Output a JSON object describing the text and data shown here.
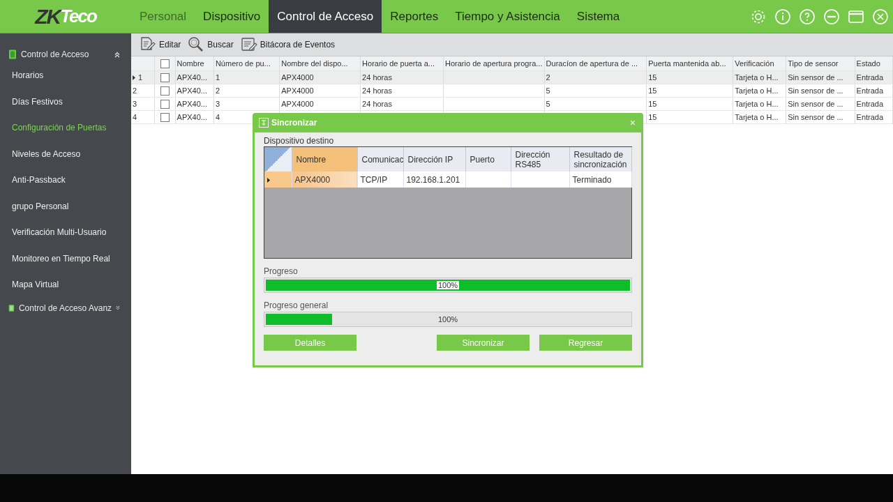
{
  "logo": {
    "dark": "ZK",
    "light": "Teco"
  },
  "nav": [
    {
      "label": "Personal",
      "selected": false,
      "dim": true
    },
    {
      "label": "Dispositivo",
      "selected": false,
      "dim": false
    },
    {
      "label": "Control de Acceso",
      "selected": true,
      "dim": false
    },
    {
      "label": "Reportes",
      "selected": false,
      "dim": false
    },
    {
      "label": "Tiempo y Asistencia",
      "selected": false,
      "dim": false
    },
    {
      "label": "Sistema",
      "selected": false,
      "dim": false
    }
  ],
  "sidebar": {
    "sections": [
      {
        "title": "Control de Acceso",
        "expanded": true,
        "items": [
          {
            "label": "Horarios",
            "selected": false
          },
          {
            "label": "Días Festivos",
            "selected": false
          },
          {
            "label": "Configuración de Puertas",
            "selected": true
          },
          {
            "label": "Niveles de Acceso",
            "selected": false
          },
          {
            "label": "Anti-Passback",
            "selected": false
          },
          {
            "label": "grupo Personal",
            "selected": false
          },
          {
            "label": "Verificación Multi-Usuario",
            "selected": false
          },
          {
            "label": "Monitoreo en Tiempo Real",
            "selected": false
          },
          {
            "label": "Mapa Virtual",
            "selected": false
          }
        ]
      },
      {
        "title": "Control de Acceso Avanz",
        "expanded": false
      }
    ]
  },
  "toolbar": [
    {
      "label": "Editar"
    },
    {
      "label": "Buscar"
    },
    {
      "label": "Bitácora de Eventos"
    }
  ],
  "table": {
    "header_checked": false,
    "columns": [
      "Nombre",
      "Número de pu...",
      "Nombre del dispo...",
      "Horario de puerta a...",
      "Horario de apertura progra...",
      "Duracíon de apertura de ...",
      "Puerta mantenida ab...",
      "Verificación",
      "Tipo de sensor",
      "Estado"
    ],
    "rows": [
      {
        "number": "1",
        "selected": true,
        "checked": false,
        "cells": [
          "APX40...",
          "1",
          "APX4000",
          "24 horas",
          null,
          "2",
          "15",
          "Tarjeta o H...",
          "Sin sensor de ...",
          "Entrada"
        ]
      },
      {
        "number": "2",
        "selected": false,
        "checked": false,
        "cells": [
          "APX40...",
          "2",
          "APX4000",
          "24 horas",
          null,
          "5",
          "15",
          "Tarjeta o H...",
          "Sin sensor de ...",
          "Entrada"
        ]
      },
      {
        "number": "3",
        "selected": false,
        "checked": false,
        "cells": [
          "APX40...",
          "3",
          "APX4000",
          "24 horas",
          null,
          "5",
          "15",
          "Tarjeta o H...",
          "Sin sensor de ...",
          "Entrada"
        ]
      },
      {
        "number": "4",
        "selected": false,
        "checked": false,
        "cells": [
          "APX40...",
          "4",
          null,
          null,
          null,
          null,
          "15",
          "Tarjeta o H...",
          "Sin sensor de ...",
          "Entrada"
        ]
      }
    ]
  },
  "dialog": {
    "title": "Sincronizar",
    "close": "×",
    "section_label": "Dispositivo destino",
    "grid": {
      "columns": [
        "Nombre",
        "Comunicac",
        "Dirección IP",
        "Puerto",
        "Dirección RS485",
        "Resultado de sincronización"
      ],
      "rows": [
        {
          "selected": true,
          "cells": [
            "APX4000",
            "TCP/IP",
            "192.168.1.201",
            null,
            null,
            "Terminado"
          ]
        }
      ]
    },
    "progress": [
      {
        "label": "Progreso",
        "level": 1,
        "reading": "100%"
      },
      {
        "label": "Progreso general",
        "level": 0.18,
        "reading": "100%"
      }
    ],
    "buttons": [
      "Detalles",
      "Sincronizar",
      "Regresar"
    ]
  }
}
